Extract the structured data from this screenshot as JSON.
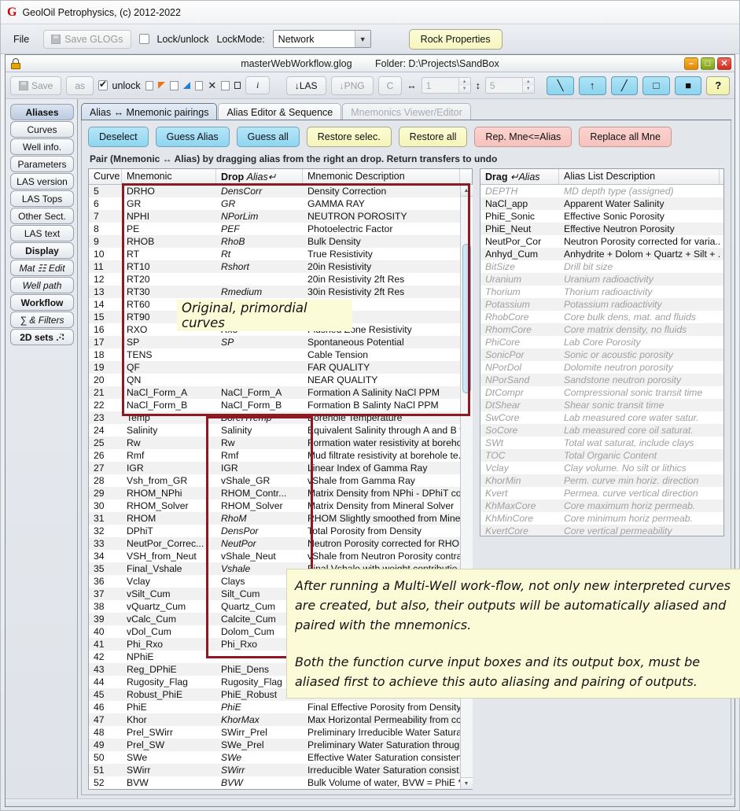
{
  "app": {
    "logo": "G",
    "title": "GeolOil Petrophysics, (c) 2012-2022",
    "menu": {
      "file": "File"
    },
    "save_glogs": "Save GLOGs",
    "lock_unlock": "Lock/unlock",
    "lockmode_label": "LockMode:",
    "lockmode_value": "Network",
    "rock_properties": "Rock  Properties"
  },
  "window": {
    "filename": "masterWebWorkflow.glog",
    "folder": "Folder: D:\\Projects\\SandBox",
    "minimize": "–",
    "maximize": "□",
    "close": "✕"
  },
  "toolbar": {
    "save": "Save",
    "as": "as",
    "unlock": "unlock",
    "info": "i",
    "las": "↓LAS",
    "png": "↓PNG",
    "c": "C",
    "width_value": "1",
    "height_value": "5",
    "width_icon": "↔",
    "height_icon": "↕",
    "tool_line": "╲",
    "tool_up": "↑",
    "tool_arrow": "╱",
    "tool_rect": "□",
    "tool_fill": "■",
    "help": "?"
  },
  "rail": {
    "items": [
      {
        "label": "Aliases",
        "style": "sel"
      },
      {
        "label": "Curves",
        "style": ""
      },
      {
        "label": "Well info.",
        "style": ""
      },
      {
        "label": "Parameters",
        "style": ""
      },
      {
        "label": "LAS version",
        "style": ""
      },
      {
        "label": "LAS Tops",
        "style": ""
      },
      {
        "label": "Other Sect.",
        "style": ""
      },
      {
        "label": "LAS text",
        "style": ""
      },
      {
        "label": "Display",
        "style": "b"
      },
      {
        "label": "Mat ☷ Edit",
        "style": "i"
      },
      {
        "label": "Well path",
        "style": "i"
      },
      {
        "label": "Workflow",
        "style": "b"
      },
      {
        "label": "∑ & Filters",
        "style": "i"
      },
      {
        "label": "2D sets .·̈∶",
        "style": "b"
      }
    ]
  },
  "tabs": [
    {
      "label": "Alias ↔ Mnemonic pairings",
      "state": "sel"
    },
    {
      "label": "Alias Editor & Sequence",
      "state": ""
    },
    {
      "label": "Mnemonics Viewer/Editor",
      "state": "dis"
    }
  ],
  "actions": [
    {
      "label": "Deselect",
      "kind": "cyan"
    },
    {
      "label": "Guess Alias",
      "kind": "cyan"
    },
    {
      "label": "Guess all",
      "kind": "cyan"
    },
    {
      "label": "Restore selec.",
      "kind": "yel"
    },
    {
      "label": "Restore all",
      "kind": "yel"
    },
    {
      "label": "Rep. Mne<=Alias",
      "kind": "pink"
    },
    {
      "label": "Replace all Mne",
      "kind": "pink"
    }
  ],
  "hint": "Pair (Mnemonic ↔ Alias) by dragging alias from the right an drop. Return transfers to undo",
  "left_table": {
    "headers": [
      "Curve",
      "Mnemonic",
      "Drop Alias↵",
      "Mnemonic Description"
    ],
    "rows": [
      [
        "5",
        "DRHO",
        "DensCorr",
        "Density Correction",
        "i"
      ],
      [
        "6",
        "GR",
        "GR",
        "GAMMA RAY",
        "i"
      ],
      [
        "7",
        "NPHI",
        "NPorLim",
        "NEUTRON POROSITY",
        "i"
      ],
      [
        "8",
        "PE",
        "PEF",
        "Photoelectric Factor",
        "i"
      ],
      [
        "9",
        "RHOB",
        "RhoB",
        "Bulk Density",
        "i"
      ],
      [
        "10",
        "RT",
        "Rt",
        "True Resistivity",
        "i"
      ],
      [
        "11",
        "RT10",
        "Rshort",
        "20in Resistivity",
        "i"
      ],
      [
        "12",
        "RT20",
        "",
        "20in Resistivity 2ft Res",
        "i"
      ],
      [
        "13",
        "RT30",
        "Rmedium",
        "30in Resistivity 2ft Res",
        "i"
      ],
      [
        "14",
        "RT60",
        "",
        "",
        "i"
      ],
      [
        "15",
        "RT90",
        "",
        "",
        "i"
      ],
      [
        "16",
        "RXO",
        "Rxo",
        "Flushed Zone Resistivity",
        "i"
      ],
      [
        "17",
        "SP",
        "SP",
        "Spontaneous Potential",
        "i"
      ],
      [
        "18",
        "TENS",
        "",
        "Cable Tension",
        "i"
      ],
      [
        "19",
        "QF",
        "",
        "FAR QUALITY",
        "i"
      ],
      [
        "20",
        "QN",
        "",
        "NEAR QUALITY",
        "i"
      ],
      [
        "21",
        "NaCl_Form_A",
        "NaCl_Form_A",
        "Formation A Salinity NaCl PPM",
        "n"
      ],
      [
        "22",
        "NaCl_Form_B",
        "NaCl_Form_B",
        "Formation B Salinty NaCl PPM",
        "n"
      ],
      [
        "23",
        "Temp",
        "BoreHTemp",
        "Borehole Temperature",
        "i"
      ],
      [
        "24",
        "Salinity",
        "Salinity",
        "Equivalent Salinity through A and B f...",
        "n"
      ],
      [
        "25",
        "Rw",
        "Rw",
        "Formation water resistivity at boreho...",
        "n"
      ],
      [
        "26",
        "Rmf",
        "Rmf",
        "Mud filtrate resistivity at borehole te...",
        "n"
      ],
      [
        "27",
        "IGR",
        "IGR",
        "Linear Index of Gamma Ray",
        "n"
      ],
      [
        "28",
        "Vsh_from_GR",
        "vShale_GR",
        "vShale from Gamma Ray",
        "n"
      ],
      [
        "29",
        "RHOM_NPhi",
        "RHOM_Contr...",
        "Matrix Density from NPhi - DPhiT co...",
        "n"
      ],
      [
        "30",
        "RHOM_Solver",
        "RHOM_Solver",
        "Matrix Density from Mineral Solver",
        "n"
      ],
      [
        "31",
        "RHOM",
        "RhoM",
        "RHOM Slightly smoothed from Mine...",
        "i"
      ],
      [
        "32",
        "DPhiT",
        "DensPor",
        "Total Porosity from Density",
        "i"
      ],
      [
        "33",
        "NeutPor_Correc...",
        "NeutPor",
        "Neutron Porosity corrected for RHOM",
        "i"
      ],
      [
        "34",
        "VSH_from_Neut",
        "vShale_Neut",
        "vShale from Neutron Porosity contrast",
        "n"
      ],
      [
        "35",
        "Final_Vshale",
        "Vshale",
        "Final Vshale with weight contributio...",
        "i"
      ],
      [
        "36",
        "Vclay",
        "Clays",
        "",
        "n"
      ],
      [
        "37",
        "vSilt_Cum",
        "Silt_Cum",
        "",
        "n"
      ],
      [
        "38",
        "vQuartz_Cum",
        "Quartz_Cum",
        "",
        "n"
      ],
      [
        "39",
        "vCalc_Cum",
        "Calcite_Cum",
        "",
        "n"
      ],
      [
        "40",
        "vDol_Cum",
        "Dolom_Cum",
        "",
        "n"
      ],
      [
        "41",
        "Phi_Rxo",
        "Phi_Rxo",
        "",
        "n"
      ],
      [
        "42",
        "NPhiE",
        "",
        "",
        "n"
      ],
      [
        "43",
        "Reg_DPhiE",
        "PhiE_Dens",
        "",
        "n"
      ],
      [
        "44",
        "Rugosity_Flag",
        "Rugosity_Flag",
        "",
        "n"
      ],
      [
        "45",
        "Robust_PhiE",
        "PhiE_Robust",
        "",
        "n"
      ],
      [
        "46",
        "PhiE",
        "PhiE",
        "Final Effective Porosity from Density ...",
        "i"
      ],
      [
        "47",
        "Khor",
        "KhorMax",
        "Max Horizontal Permeability from co...",
        "i"
      ],
      [
        "48",
        "Prel_SWirr",
        "SWirr_Prel",
        "Preliminary Irreducible Water Satura...",
        "n"
      ],
      [
        "49",
        "Prel_SW",
        "SWe_Prel",
        "Preliminary Water Saturation throug...",
        "n"
      ],
      [
        "50",
        "SWe",
        "SWe",
        "Effective Water Saturation consisten...",
        "i"
      ],
      [
        "51",
        "SWirr",
        "SWirr",
        "Irreducible Water Saturation consist...",
        "i"
      ],
      [
        "52",
        "BVW",
        "BVW",
        "Bulk Volume of water, BVW = PhiE * ...",
        "i"
      ]
    ]
  },
  "right_table": {
    "headers": [
      "Drag ↵Alias",
      "Alias List Description"
    ],
    "rows": [
      [
        "DEPTH",
        "MD depth type (assigned)",
        "g"
      ],
      [
        "NaCl_app",
        "Apparent Water Salinity",
        "n"
      ],
      [
        "PhiE_Sonic",
        "Effective Sonic Porosity",
        "n"
      ],
      [
        "PhiE_Neut",
        "Effective Neutron Porosity",
        "n"
      ],
      [
        "NeutPor_Cor",
        "Neutron Porosity corrected for varia...",
        "n"
      ],
      [
        "Anhyd_Cum",
        "Anhydrite + Dolom + Quartz + Silt + ...",
        "n"
      ],
      [
        "BitSize",
        "Drill bit size",
        "g"
      ],
      [
        "Uranium",
        "Uranium radioactivity",
        "g"
      ],
      [
        "Thorium",
        "Thorium radioactivity",
        "g"
      ],
      [
        "Potassium",
        "Potassium radioactivity",
        "g"
      ],
      [
        "RhobCore",
        "Core bulk dens, mat. and fluids",
        "g"
      ],
      [
        "RhomCore",
        "Core matrix density, no fluids",
        "g"
      ],
      [
        "PhiCore",
        "Lab Core Porosity",
        "g"
      ],
      [
        "SonicPor",
        "Sonic or acoustic porosity",
        "g"
      ],
      [
        "NPorDol",
        "Dolomite neutron porosity",
        "g"
      ],
      [
        "NPorSand",
        "Sandstone neutron porosity",
        "g"
      ],
      [
        "DtCompr",
        "Compressional sonic transit time",
        "g"
      ],
      [
        "DtShear",
        "Shear sonic transit time",
        "g"
      ],
      [
        "SwCore",
        "Lab measured core water satur.",
        "g"
      ],
      [
        "SoCore",
        "Lab measured core oil saturat.",
        "g"
      ],
      [
        "SWt",
        "Total wat saturat, include clays",
        "g"
      ],
      [
        "TOC",
        "Total Organic Content",
        "g"
      ],
      [
        "Vclay",
        "Clay volume. No silt or lithics",
        "g"
      ],
      [
        "KhorMin",
        "Perm. curve min horiz. direction",
        "g"
      ],
      [
        "Kvert",
        "Permea. curve vertical direction",
        "g"
      ],
      [
        "KhMaxCore",
        "Core maximum horiz permeab.",
        "g"
      ],
      [
        "KhMinCore",
        "Core minimum horiz permeab.",
        "g"
      ],
      [
        "KvertCore",
        "Core vertical permeability",
        "g"
      ]
    ]
  },
  "annotations": {
    "primordial": "Original, primordial curves",
    "para1": "After running a Multi-Well work-flow, not only new interpreted curves are created, but also, their outputs will be automatically aliased and paired with the mnemonics.",
    "para2": "Both the function curve input boxes and its output box, must be aliased first to achieve this auto aliasing and pairing of outputs."
  },
  "colors": {
    "highlight_box": "#8c1a22",
    "note_bg": "#fbfbd8",
    "accent_cyan": "#8fd5f0",
    "accent_yellow": "#f5f4ba",
    "accent_pink": "#f6c2bd"
  }
}
